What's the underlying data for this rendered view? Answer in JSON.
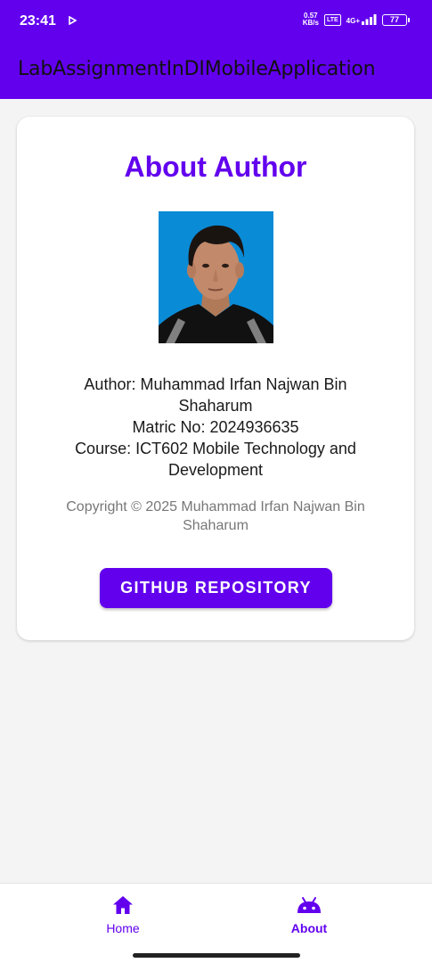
{
  "status_bar": {
    "time": "23:41",
    "speed_value": "0.57",
    "speed_unit": "KB/s",
    "volte": "LTE",
    "network": "4G+",
    "battery": "77"
  },
  "app_bar": {
    "title": "LabAssignmentInDIMobileApplication"
  },
  "card": {
    "title": "About Author",
    "photo_alt": "author-photo",
    "author_line": "Author: Muhammad Irfan Najwan Bin Shaharum",
    "matric_line": "Matric No: 2024936635",
    "course_line": "Course: ICT602 Mobile Technology and Development",
    "copyright": "Copyright © 2025 Muhammad Irfan Najwan Bin Shaharum",
    "github_button": "GITHUB REPOSITORY"
  },
  "bottom_nav": {
    "items": [
      {
        "label": "Home",
        "icon": "home-icon",
        "selected": false
      },
      {
        "label": "About",
        "icon": "android-icon",
        "selected": true
      }
    ]
  },
  "colors": {
    "primary": "#6200ee",
    "background": "#f4f4f4",
    "card": "#ffffff"
  }
}
